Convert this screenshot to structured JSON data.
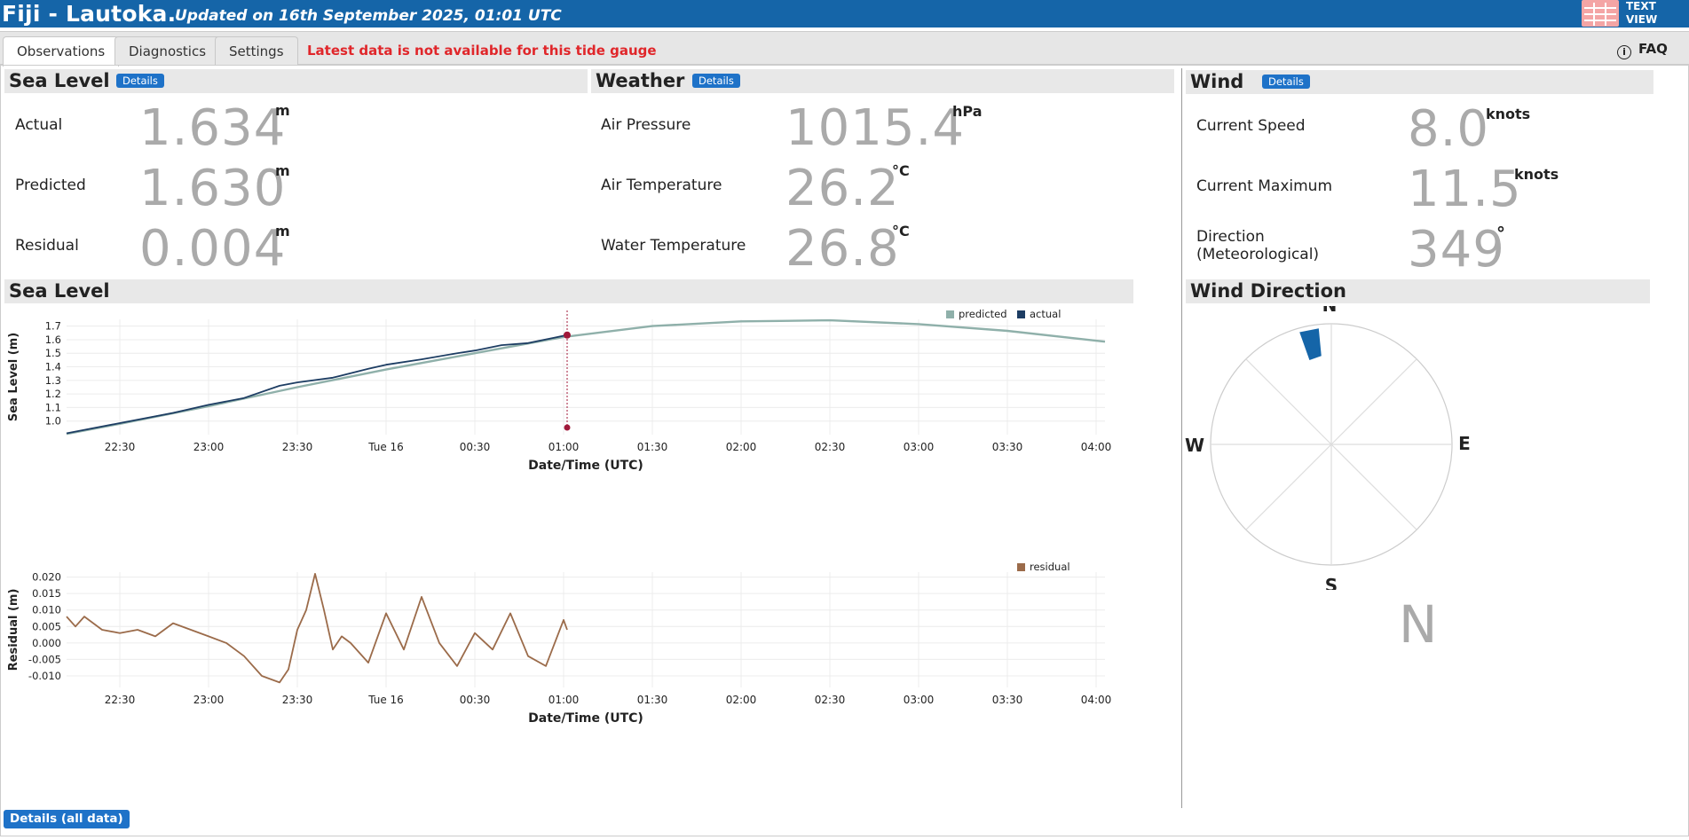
{
  "header": {
    "title": "Fiji - Lautoka.",
    "updated": "Updated on 16th September 2025, 01:01 UTC",
    "text_view_line1": "TEXT",
    "text_view_line2": "VIEW"
  },
  "tabs": [
    {
      "label": "Observations",
      "active": true
    },
    {
      "label": "Diagnostics",
      "active": false
    },
    {
      "label": "Settings",
      "active": false
    }
  ],
  "status_message": "Latest data is not available for this tide gauge",
  "faq_label": "FAQ",
  "details_label": "Details",
  "sea_level": {
    "title": "Sea Level",
    "rows": [
      {
        "label": "Actual",
        "value": "1.634",
        "unit": "m"
      },
      {
        "label": "Predicted",
        "value": "1.630",
        "unit": "m"
      },
      {
        "label": "Residual",
        "value": "0.004",
        "unit": "m"
      }
    ]
  },
  "weather": {
    "title": "Weather",
    "rows": [
      {
        "label": "Air Pressure",
        "value": "1015.4",
        "unit": "hPa"
      },
      {
        "label": "Air Temperature",
        "value": "26.2",
        "unit": "°C"
      },
      {
        "label": "Water Temperature",
        "value": "26.8",
        "unit": "°C"
      }
    ]
  },
  "wind": {
    "title": "Wind",
    "rows": [
      {
        "label": "Current Speed",
        "value": "8.0",
        "unit": "knots"
      },
      {
        "label": "Current Maximum",
        "value": "11.5",
        "unit": "knots"
      },
      {
        "label": "Direction",
        "label2": "(Meteorological)",
        "value": "349",
        "unit": "°"
      }
    ]
  },
  "sea_level_chart_title": "Sea Level",
  "wind_direction": {
    "title": "Wind Direction",
    "compass": [
      "N",
      "E",
      "S",
      "W"
    ],
    "direction_deg": 349,
    "direction_label": "N",
    "bar_color": "#1565a8"
  },
  "bottom_button": "Details (all data)",
  "colors": {
    "header_bg": "#1565a8",
    "predicted": "#8fb0aa",
    "actual": "#1d3d63",
    "residual": "#9b6b4a",
    "marker": "#a0193a"
  },
  "chart_data": [
    {
      "type": "line",
      "ylabel": "Sea Level (m)",
      "xlabel": "Date/Time (UTC)",
      "x_ticks": [
        "22:30",
        "23:00",
        "23:30",
        "Tue 16",
        "00:30",
        "01:00",
        "01:30",
        "02:00",
        "02:30",
        "03:00",
        "03:30",
        "04:00"
      ],
      "y_ticks": [
        1.0,
        1.1,
        1.2,
        1.3,
        1.4,
        1.5,
        1.6,
        1.7
      ],
      "ylim": [
        0.9,
        1.75
      ],
      "xlim_hours": [
        -1.8,
        4.05
      ],
      "legend_position": "top-right",
      "current_time": "01:00",
      "series": [
        {
          "name": "predicted",
          "x": [
            -1.8,
            -1.5,
            -1.0,
            -0.5,
            0.0,
            0.5,
            1.0,
            1.5,
            2.0,
            2.5,
            3.0,
            3.5,
            4.05
          ],
          "values": [
            0.905,
            0.98,
            1.11,
            1.25,
            1.38,
            1.5,
            1.62,
            1.7,
            1.735,
            1.743,
            1.715,
            1.665,
            1.585
          ]
        },
        {
          "name": "actual",
          "x": [
            -1.8,
            -1.5,
            -1.2,
            -1.0,
            -0.8,
            -0.6,
            -0.5,
            -0.3,
            -0.1,
            0.0,
            0.2,
            0.4,
            0.5,
            0.65,
            0.8,
            0.95,
            1.02
          ],
          "values": [
            0.91,
            0.985,
            1.06,
            1.12,
            1.17,
            1.26,
            1.285,
            1.32,
            1.385,
            1.415,
            1.455,
            1.5,
            1.52,
            1.56,
            1.575,
            1.615,
            1.634
          ]
        }
      ]
    },
    {
      "type": "line",
      "ylabel": "Residual (m)",
      "xlabel": "Date/Time (UTC)",
      "x_ticks": [
        "22:30",
        "23:00",
        "23:30",
        "Tue 16",
        "00:30",
        "01:00",
        "01:30",
        "02:00",
        "02:30",
        "03:00",
        "03:30",
        "04:00"
      ],
      "y_ticks": [
        -0.01,
        -0.005,
        0.0,
        0.005,
        0.01,
        0.015,
        0.02
      ],
      "ylim": [
        -0.0135,
        0.0215
      ],
      "xlim_hours": [
        -1.8,
        4.05
      ],
      "legend_position": "top-right",
      "series": [
        {
          "name": "residual",
          "x": [
            -1.8,
            -1.75,
            -1.7,
            -1.6,
            -1.5,
            -1.4,
            -1.3,
            -1.2,
            -1.1,
            -1.0,
            -0.9,
            -0.8,
            -0.7,
            -0.6,
            -0.55,
            -0.5,
            -0.45,
            -0.4,
            -0.35,
            -0.3,
            -0.25,
            -0.2,
            -0.1,
            0.0,
            0.1,
            0.2,
            0.3,
            0.4,
            0.5,
            0.6,
            0.7,
            0.8,
            0.9,
            1.0,
            1.02
          ],
          "values": [
            0.008,
            0.005,
            0.008,
            0.004,
            0.003,
            0.004,
            0.002,
            0.006,
            0.004,
            0.002,
            0.0,
            -0.004,
            -0.01,
            -0.012,
            -0.008,
            0.004,
            0.01,
            0.021,
            0.01,
            -0.002,
            0.002,
            0.0,
            -0.006,
            0.009,
            -0.002,
            0.014,
            0.0,
            -0.007,
            0.003,
            -0.002,
            0.009,
            -0.004,
            -0.007,
            0.007,
            0.004
          ]
        }
      ]
    }
  ]
}
